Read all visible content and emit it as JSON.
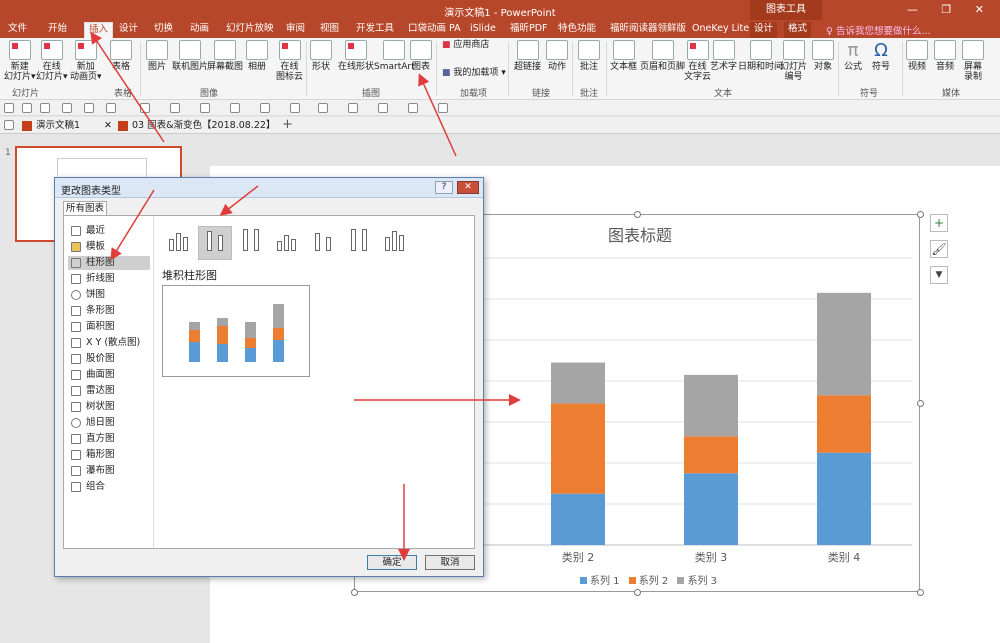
{
  "window": {
    "title": "演示文稿1 - PowerPoint",
    "context_tab": "图表工具",
    "controls": "— ❐ ✕"
  },
  "tabs": [
    "文件",
    "开始",
    "插入",
    "设计",
    "切换",
    "动画",
    "幻灯片放映",
    "审阅",
    "视图",
    "开发工具",
    "口袋动画 PA",
    "iSlide",
    "福昕PDF",
    "特色功能",
    "福昕阅读器领鲜版",
    "OneKey Lite",
    "设计",
    "格式"
  ],
  "tell_me": "♀ 告诉我您想要做什么...",
  "ribbon": {
    "buttons": [
      "新建\n幻灯片▾",
      "在线\n幻灯片▾",
      "新加\n动画页▾",
      "表格",
      "图片",
      "联机图片",
      "屏幕截图",
      "相册",
      "在线\n图标云",
      "形状",
      "在线形状",
      "SmartArt",
      "图表",
      "超链接",
      "动作",
      "批注",
      "文本框",
      "页眉和页脚",
      "在线\n文字云",
      "艺术字",
      "日期和时间",
      "幻灯片\n编号",
      "对象",
      "公式",
      "符号",
      "视频",
      "音频",
      "屏幕\n录制"
    ],
    "addins": [
      "应用商店",
      "我的加载项 ▾"
    ],
    "groups": [
      "幻灯片",
      "表格",
      "图像",
      "插图",
      "加载项",
      "链接",
      "批注",
      "文本",
      "符号",
      "媒体"
    ]
  },
  "doc_tabs": [
    "演示文稿1",
    "03 图表&渐变色【2018.08.22】"
  ],
  "doc_close": "✕",
  "new_tab": "+",
  "slide_number": "1",
  "dialog": {
    "title": "更改图表类型",
    "help_btn": "?",
    "close_btn": "✕",
    "tab": "所有图表",
    "list": [
      "最近",
      "模板",
      "柱形图",
      "折线图",
      "饼图",
      "条形图",
      "面积图",
      "X Y (散点图)",
      "股价图",
      "曲面图",
      "雷达图",
      "树状图",
      "旭日图",
      "直方图",
      "箱形图",
      "瀑布图",
      "组合"
    ],
    "selected": "柱形图",
    "variant_name": "堆积柱形图",
    "ok": "确定",
    "cancel": "取消"
  },
  "chart_side_buttons": {
    "elements": "+",
    "styles": "🖌",
    "filter": "▼"
  },
  "colors": {
    "accent": "#b7472a",
    "s1": "#5b9bd5",
    "s2": "#ed7d31",
    "s3": "#a5a5a5"
  },
  "chart_data": {
    "type": "bar",
    "stacked": true,
    "title": "图表标题",
    "categories": [
      "类别 2",
      "类别 3",
      "类别 4"
    ],
    "series": [
      {
        "name": "系列 1",
        "values": [
          2.5,
          3.5,
          4.5
        ]
      },
      {
        "name": "系列 2",
        "values": [
          4.4,
          1.8,
          2.8
        ]
      },
      {
        "name": "系列 3",
        "values": [
          2.0,
          3.0,
          5.0
        ]
      }
    ],
    "ylim": [
      0,
      14
    ],
    "grid": true,
    "legend": "bottom"
  }
}
